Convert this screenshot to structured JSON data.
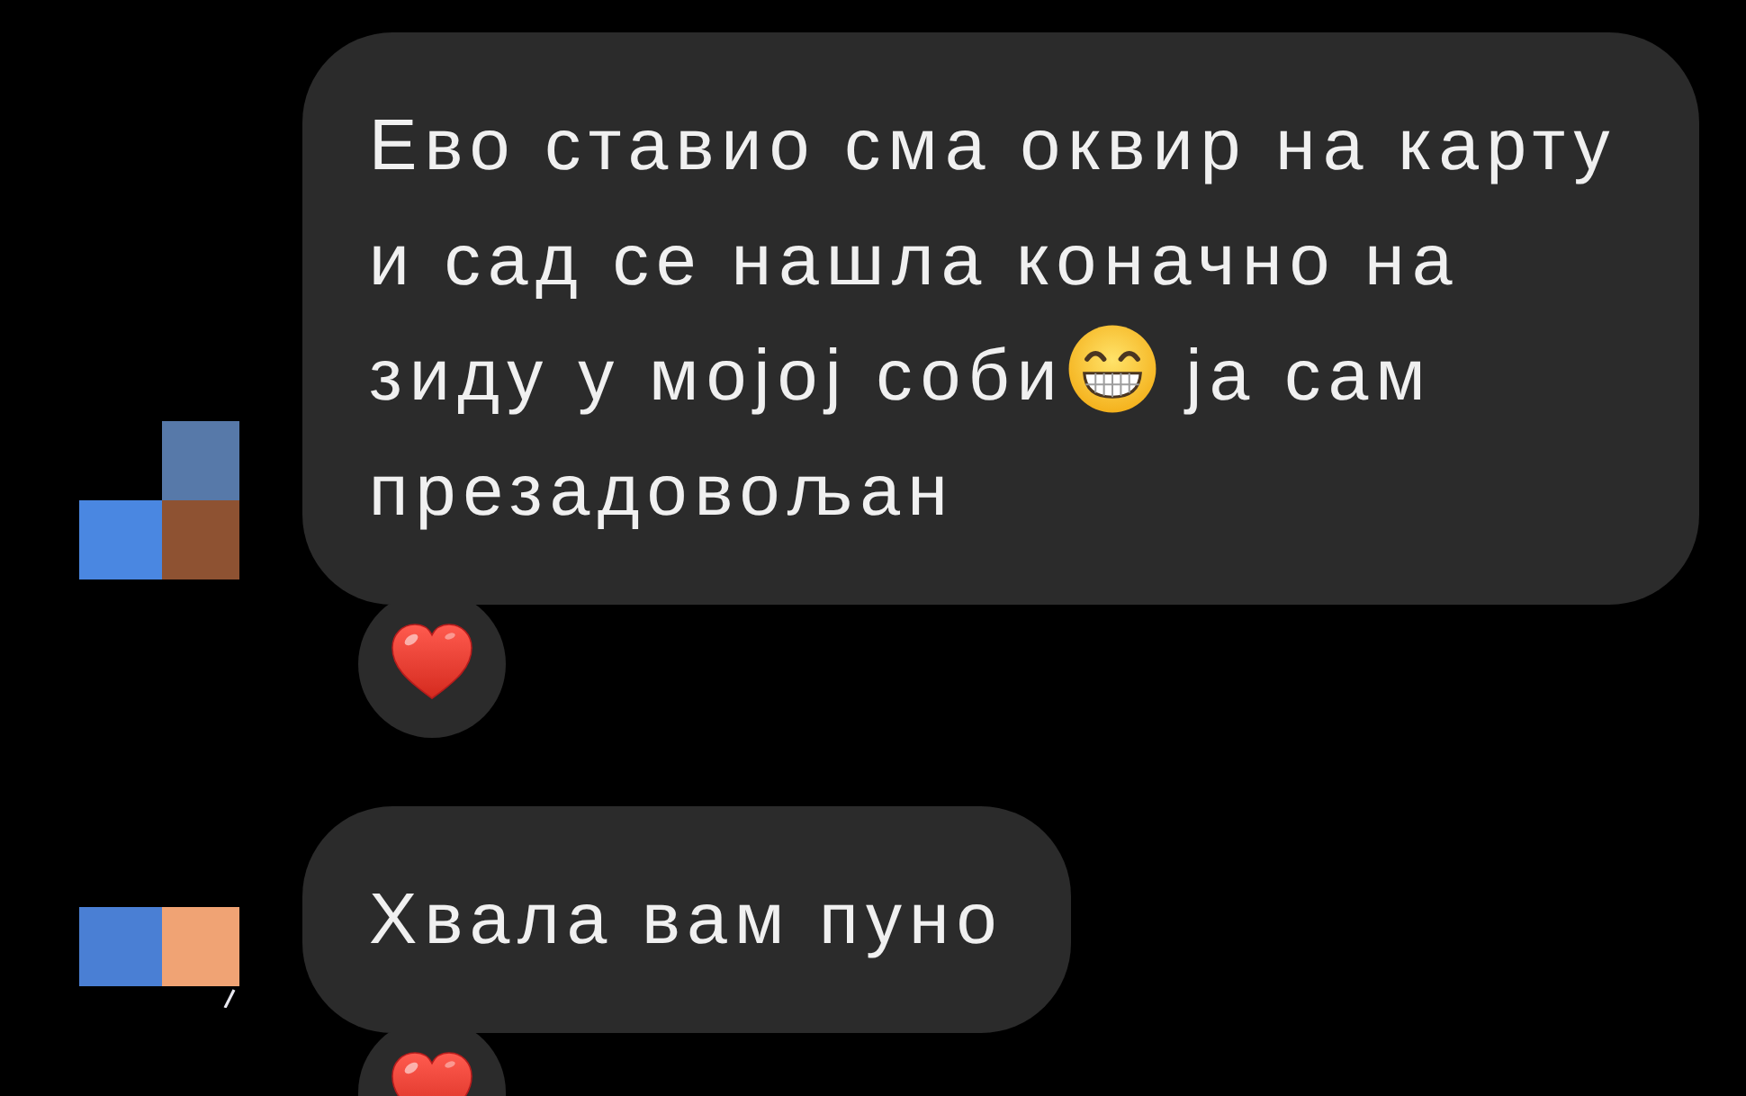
{
  "messages": [
    {
      "parts": [
        {
          "kind": "text",
          "text": "Ево ставио сма оквир на карту и сад се нашла коначно на зиду у мојој соби"
        },
        {
          "kind": "emoji"
        },
        {
          "kind": "text",
          "text": "ја сам презадовољан"
        }
      ],
      "reacted": true
    },
    {
      "parts": [
        {
          "kind": "text",
          "text": "Хвала вам пуно"
        }
      ],
      "reacted": true
    }
  ]
}
